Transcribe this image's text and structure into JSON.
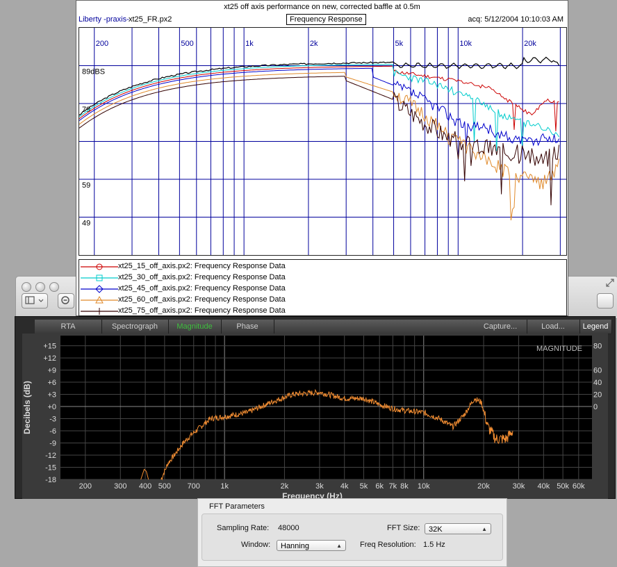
{
  "mac_window": {
    "traffic_lights": [
      "close",
      "minimize",
      "zoom"
    ],
    "sidebar_icon": "sidebar-toggle-icon",
    "zoom_icon": "zoom-out-icon"
  },
  "liberty": {
    "title": "xt25 off axis performance on new, corrected baffle at 0.5m",
    "app": "Liberty -praxis-",
    "file": "xt25_FR.px2",
    "mode": "Frequency Response",
    "acq": "acq: 5/12/2004 10:10:03 AM",
    "freq_ticks": [
      {
        "label": "200",
        "hz": 200
      },
      {
        "label": "500",
        "hz": 500
      },
      {
        "label": "1k",
        "hz": 1000
      },
      {
        "label": "2k",
        "hz": 2000
      },
      {
        "label": "5k",
        "hz": 5000
      },
      {
        "label": "10k",
        "hz": 10000
      },
      {
        "label": "20k",
        "hz": 20000
      }
    ],
    "db_ticks": [
      {
        "label": "89dBS",
        "db": 89
      },
      {
        "label": "79",
        "db": 79
      },
      {
        "label": "59",
        "db": 59
      },
      {
        "label": "49",
        "db": 49
      }
    ],
    "legend": [
      {
        "name": "xt25_15_off_axis.px2:",
        "desc": "Frequency Response Data",
        "color": "#cc0000",
        "marker": "circle"
      },
      {
        "name": "xt25_30_off_axis.px2:",
        "desc": "Frequency Response Data",
        "color": "#00cccc",
        "marker": "square"
      },
      {
        "name": "xt25_45_off_axis.px2:",
        "desc": "Frequency Response Data",
        "color": "#0000cc",
        "marker": "diamond"
      },
      {
        "name": "xt25_60_off_axis.px2:",
        "desc": "Frequency Response Data",
        "color": "#e08a2a",
        "marker": "triangle"
      },
      {
        "name": "xt25_75_off_axis.px2:",
        "desc": "Frequency Response Data",
        "color": "#330000",
        "marker": "plus"
      }
    ]
  },
  "analyzer": {
    "tabs": [
      {
        "label": "RTA",
        "state": "normal"
      },
      {
        "label": "Spectrograph",
        "state": "normal"
      },
      {
        "label": "Magnitude",
        "state": "active"
      },
      {
        "label": "Phase",
        "state": "normal"
      },
      {
        "label": "Capture...",
        "state": "normal"
      },
      {
        "label": "Load...",
        "state": "normal"
      },
      {
        "label": "Legend",
        "state": "bold"
      }
    ],
    "ylabel": "Decibels (dB)",
    "xlabel": "Frequency (Hz)",
    "overlay": "MAGNITUDE",
    "left_ticks": [
      "+15",
      "+12",
      "+9",
      "+6",
      "+3",
      "+0",
      "-3",
      "-6",
      "-9",
      "-12",
      "-15",
      "-18"
    ],
    "right_ticks": [
      "80",
      "60",
      "40",
      "20",
      "0"
    ],
    "x_ticks": [
      "200",
      "300",
      "400",
      "500",
      "700",
      "1k",
      "2k",
      "3k",
      "4k",
      "5k",
      "6k",
      "7k",
      "8k",
      "10k",
      "20k",
      "30k",
      "40k",
      "50k",
      "60k"
    ],
    "trace_color": "#f08c32"
  },
  "fft": {
    "title": "FFT Parameters",
    "sampling_label": "Sampling Rate:",
    "sampling_value": "48000",
    "fft_size_label": "FFT Size:",
    "fft_size_value": "32K",
    "window_label": "Window:",
    "window_value": "Hanning",
    "freq_res_label": "Freq Resolution:",
    "freq_res_value": "1.5 Hz"
  }
}
